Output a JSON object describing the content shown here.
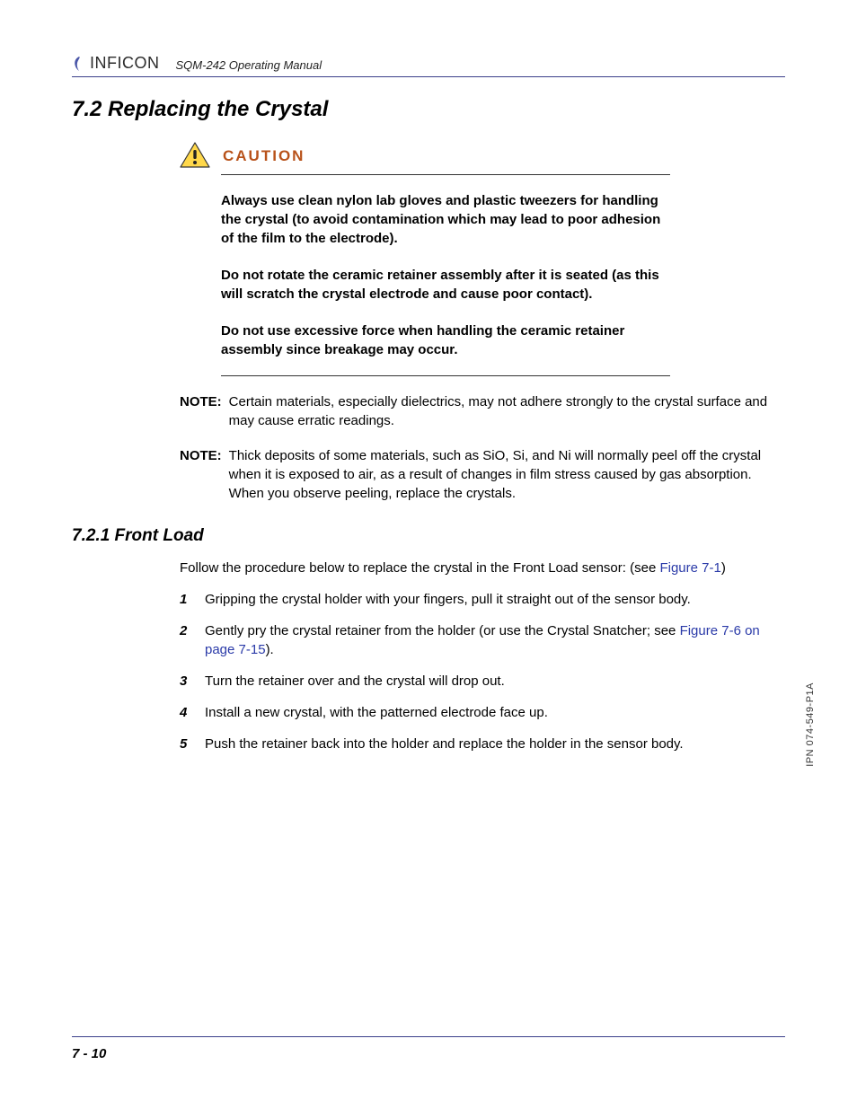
{
  "header": {
    "brand": "INFICON",
    "doc_title": "SQM-242 Operating Manual"
  },
  "section": {
    "number_title": "7.2  Replacing the Crystal"
  },
  "caution": {
    "label": "CAUTION",
    "paras": [
      "Always use clean nylon lab gloves and plastic tweezers for handling the crystal (to avoid contamination which may lead to poor adhesion of the film to the electrode).",
      "Do not rotate the ceramic retainer assembly after it is seated (as this will scratch the crystal electrode and cause poor contact).",
      "Do not use excessive force when handling the ceramic retainer assembly since breakage may occur."
    ]
  },
  "notes": [
    {
      "label": "NOTE:",
      "text": "Certain materials, especially dielectrics, may not adhere strongly to the crystal surface and may cause erratic readings."
    },
    {
      "label": "NOTE:",
      "text": "Thick deposits of some materials, such as SiO, Si, and Ni will normally peel off the crystal when it is exposed to air, as a result of changes in film stress caused by gas absorption. When you observe peeling, replace the crystals."
    }
  ],
  "subsection": {
    "heading": "7.2.1  Front Load",
    "intro_prefix": "Follow the procedure below to replace the crystal in the Front Load sensor: (see ",
    "intro_link": "Figure 7-1",
    "intro_suffix": ")"
  },
  "steps": [
    {
      "n": "1",
      "text": "Gripping the crystal holder with your fingers, pull it straight out of the sensor body."
    },
    {
      "n": "2",
      "pre": "Gently pry the crystal retainer from the holder (or use the Crystal Snatcher; see ",
      "link": "Figure 7-6 on page 7-15",
      "post": ")."
    },
    {
      "n": "3",
      "text": "Turn the retainer over and the crystal will drop out."
    },
    {
      "n": "4",
      "text": "Install a new crystal, with the patterned electrode face up."
    },
    {
      "n": "5",
      "text": "Push the retainer back into the holder and replace the holder in the sensor body."
    }
  ],
  "footer": {
    "page": "7 - 10"
  },
  "side_ipn": "IPN 074-549-P1A"
}
